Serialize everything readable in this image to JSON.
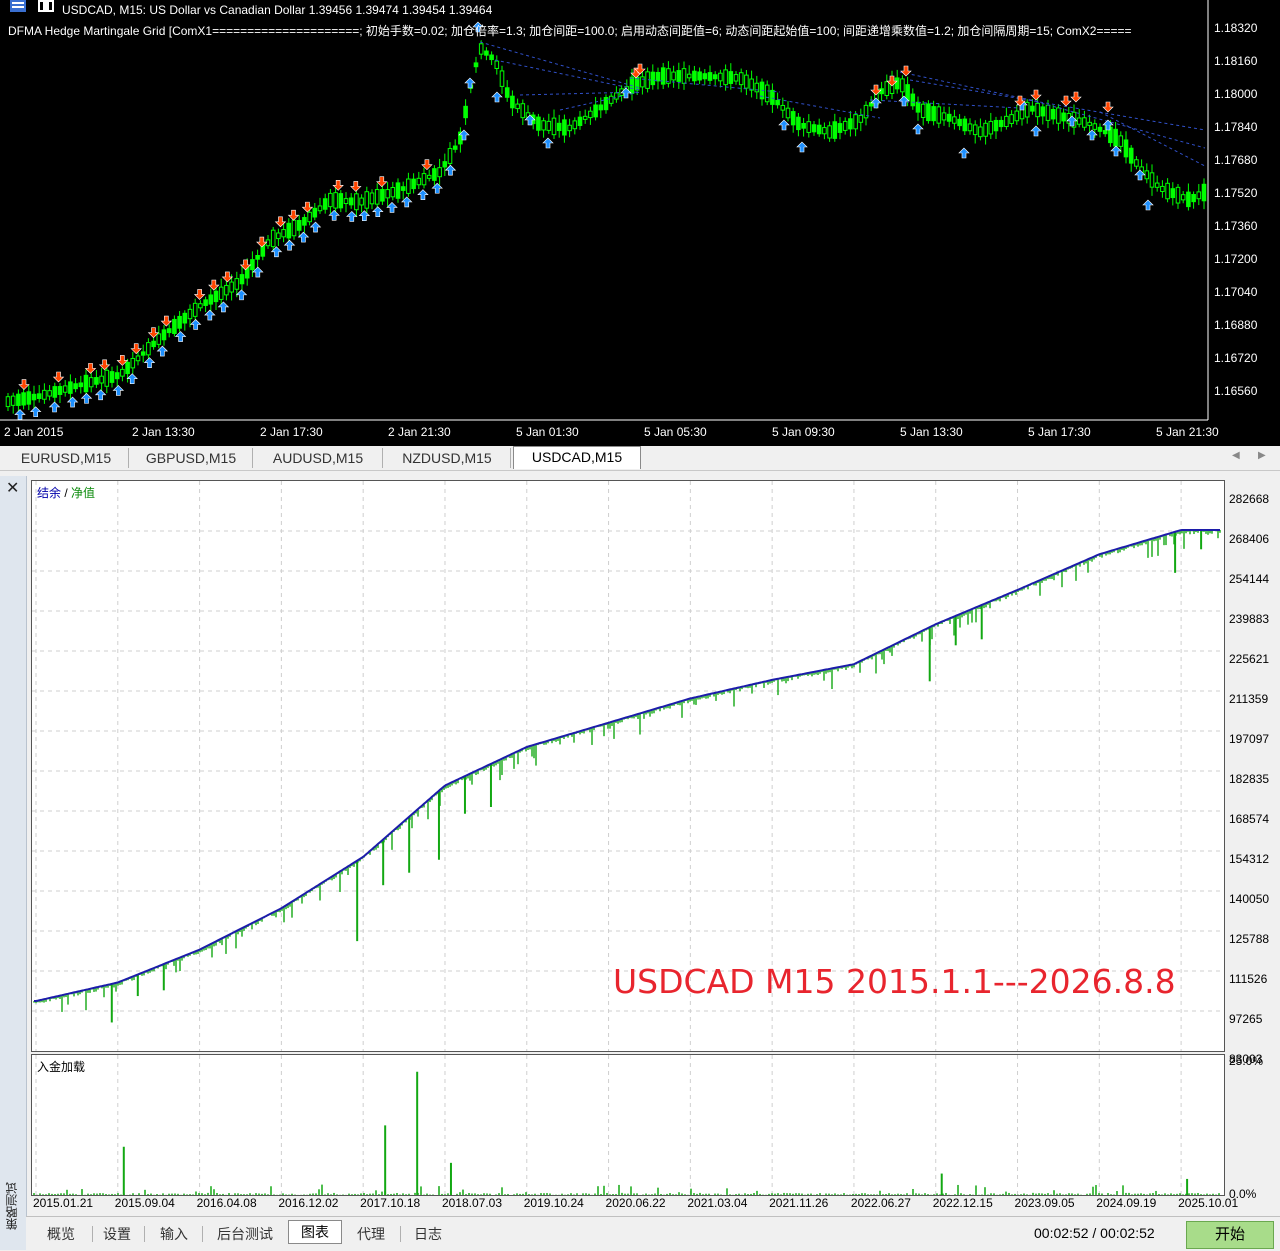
{
  "price_chart": {
    "header_line1": "USDCAD, M15:  US Dollar vs Canadian Dollar  1.39456 1.39474 1.39454 1.39464",
    "header_line2": "DFMA Hedge Martingale Grid [ComX1=====================; 初始手数=0.02; 加仓倍率=1.3; 加仓间距=100.0; 启用动态间距值=6; 动态间距起始值=100; 间距递增乘数值=1.2; 加仓间隔周期=15; ComX2=====",
    "price_labels": [
      "1.18320",
      "1.18160",
      "1.18000",
      "1.17840",
      "1.17680",
      "1.17520",
      "1.17360",
      "1.17200",
      "1.17040",
      "1.16880",
      "1.16720",
      "1.16560"
    ],
    "time_labels": [
      "2 Jan 2015",
      "2 Jan 13:30",
      "2 Jan 17:30",
      "2 Jan 21:30",
      "5 Jan 01:30",
      "5 Jan 05:30",
      "5 Jan 09:30",
      "5 Jan 13:30",
      "5 Jan 17:30",
      "5 Jan 21:30"
    ],
    "colors": {
      "background": "#000000",
      "candle": "#00ff00",
      "buy_arrow": "#1e90ff",
      "sell_arrow": "#ff4500",
      "link_line": "#3050c8"
    }
  },
  "symbol_tabs": [
    {
      "label": "EURUSD,M15"
    },
    {
      "label": "GBPUSD,M15"
    },
    {
      "label": "AUDUSD,M15"
    },
    {
      "label": "NZDUSD,M15"
    },
    {
      "label": "USDCAD,M15",
      "active": true
    }
  ],
  "tester": {
    "close_label": "✕",
    "side_label": "策略测试",
    "legend": {
      "balance": "结余",
      "separator": " / ",
      "equity": "净值"
    },
    "load_title": "入金加载",
    "overlay_text": "USDCAD M15 2015.1.1---2026.8.8",
    "equity_axis": [
      "282668",
      "268406",
      "254144",
      "239883",
      "225621",
      "211359",
      "197097",
      "182835",
      "168574",
      "154312",
      "140050",
      "125788",
      "111526",
      "97265",
      "83003"
    ],
    "load_axis": [
      "25.0%",
      "0.0%"
    ],
    "date_axis": [
      "2015.01.21",
      "2015.09.04",
      "2016.04.08",
      "2016.12.02",
      "2017.10.18",
      "2018.07.03",
      "2019.10.24",
      "2020.06.22",
      "2021.03.04",
      "2021.11.26",
      "2022.06.27",
      "2022.12.15",
      "2023.09.05",
      "2024.09.19",
      "2025.10.01"
    ],
    "colors": {
      "balance": "#1c1caa",
      "equity": "#13a813",
      "load": "#13a813",
      "overlay": "#e8252e",
      "start_button": "#a8dc8a"
    }
  },
  "chart_data": [
    {
      "type": "line",
      "title": "",
      "legend": [
        "结余",
        "净值"
      ],
      "xlabel": "",
      "ylabel": "",
      "x": [
        "2015.01.21",
        "2015.09.04",
        "2016.04.08",
        "2016.12.02",
        "2017.10.18",
        "2018.07.03",
        "2019.10.24",
        "2020.06.22",
        "2021.03.04",
        "2021.11.26",
        "2022.06.27",
        "2022.12.15",
        "2023.09.05",
        "2024.09.19",
        "2025.10.01"
      ],
      "series": [
        {
          "name": "结余",
          "values": [
            100500,
            107000,
            118500,
            133000,
            151000,
            176000,
            189500,
            198000,
            206500,
            213000,
            218500,
            232500,
            244500,
            257000,
            265500
          ]
        }
      ],
      "equity_drawdowns": [
        {
          "x": "2015.09.04",
          "low": 93000
        },
        {
          "x": "2017.10.18",
          "low": 121500
        },
        {
          "x": "2018.07.03",
          "low": 150000
        },
        {
          "x": "2022.12.15",
          "low": 212500
        },
        {
          "x": "2025.10.01",
          "low": 250500
        }
      ],
      "ylim": [
        83003,
        282668
      ],
      "grid": true
    },
    {
      "type": "bar",
      "title": "入金加载",
      "ylim": [
        0,
        25
      ],
      "unit": "%",
      "peaks": [
        {
          "x": "2015.09.04",
          "value": 9
        },
        {
          "x": "2017.10.18",
          "value": 13
        },
        {
          "x": "2017.10.18",
          "value": 23
        },
        {
          "x": "2018.07.03",
          "value": 6
        },
        {
          "x": "2022.12.15",
          "value": 4
        },
        {
          "x": "2025.10.01",
          "value": 3
        }
      ]
    }
  ],
  "bottom_tabs": [
    {
      "label": "概览"
    },
    {
      "label": "设置"
    },
    {
      "label": "输入"
    },
    {
      "label": "后台测试"
    },
    {
      "label": "图表",
      "active": true
    },
    {
      "label": "代理"
    },
    {
      "label": "日志"
    }
  ],
  "timer": "00:02:52 / 00:02:52",
  "start_button": "开始"
}
